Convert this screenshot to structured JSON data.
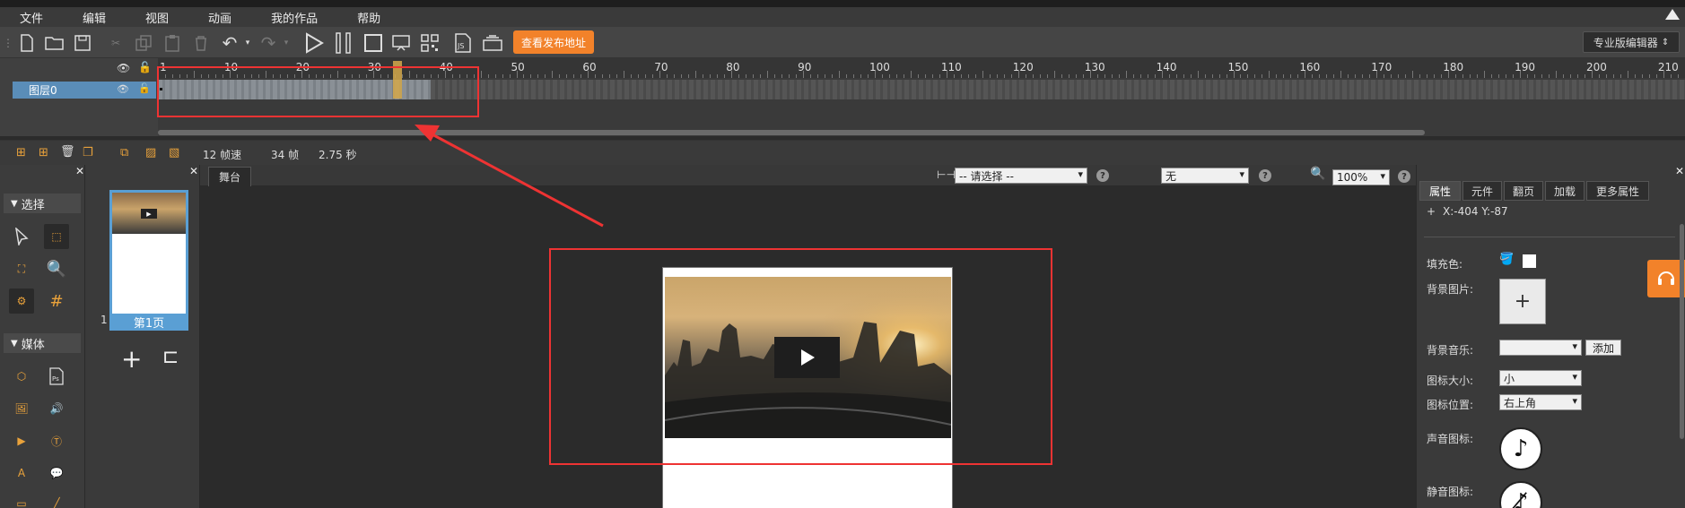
{
  "menu": [
    "文件",
    "编辑",
    "视图",
    "动画",
    "我的作品",
    "帮助"
  ],
  "toolbar": {
    "publish_label": "查看发布地址",
    "editor_mode": "专业版编辑器"
  },
  "timeline": {
    "ticks": [
      "1",
      "10",
      "20",
      "30",
      "40",
      "50",
      "60",
      "70",
      "80",
      "90",
      "100",
      "110",
      "120",
      "130",
      "140",
      "150",
      "160",
      "170",
      "180",
      "190",
      "200",
      "210"
    ],
    "layer_name": "图层0",
    "fps": "12 帧速",
    "frames": "34 帧",
    "duration": "2.75 秒"
  },
  "left_panel": {
    "select_section": "选择",
    "media_section": "媒体"
  },
  "pages": {
    "page_number": "1",
    "page_label": "第1页"
  },
  "stage": {
    "tab": "舞台",
    "select_placeholder": "-- 请选择 --",
    "effect_value": "无",
    "zoom": "100%"
  },
  "props": {
    "tabs": [
      "属性",
      "元件",
      "翻页",
      "加载",
      "更多属性"
    ],
    "coords": "X:-404   Y:-87",
    "fill_label": "填充色:",
    "bg_image_label": "背景图片:",
    "bg_music_label": "背景音乐:",
    "add_label": "添加",
    "icon_size_label": "图标大小:",
    "icon_size_value": "小",
    "icon_pos_label": "图标位置:",
    "icon_pos_value": "右上角",
    "sound_icon_label": "声音图标:",
    "mute_icon_label": "静音图标:"
  },
  "colors": {
    "accent": "#f2822a",
    "highlight": "#e33333",
    "selection": "#5a9fd4"
  }
}
